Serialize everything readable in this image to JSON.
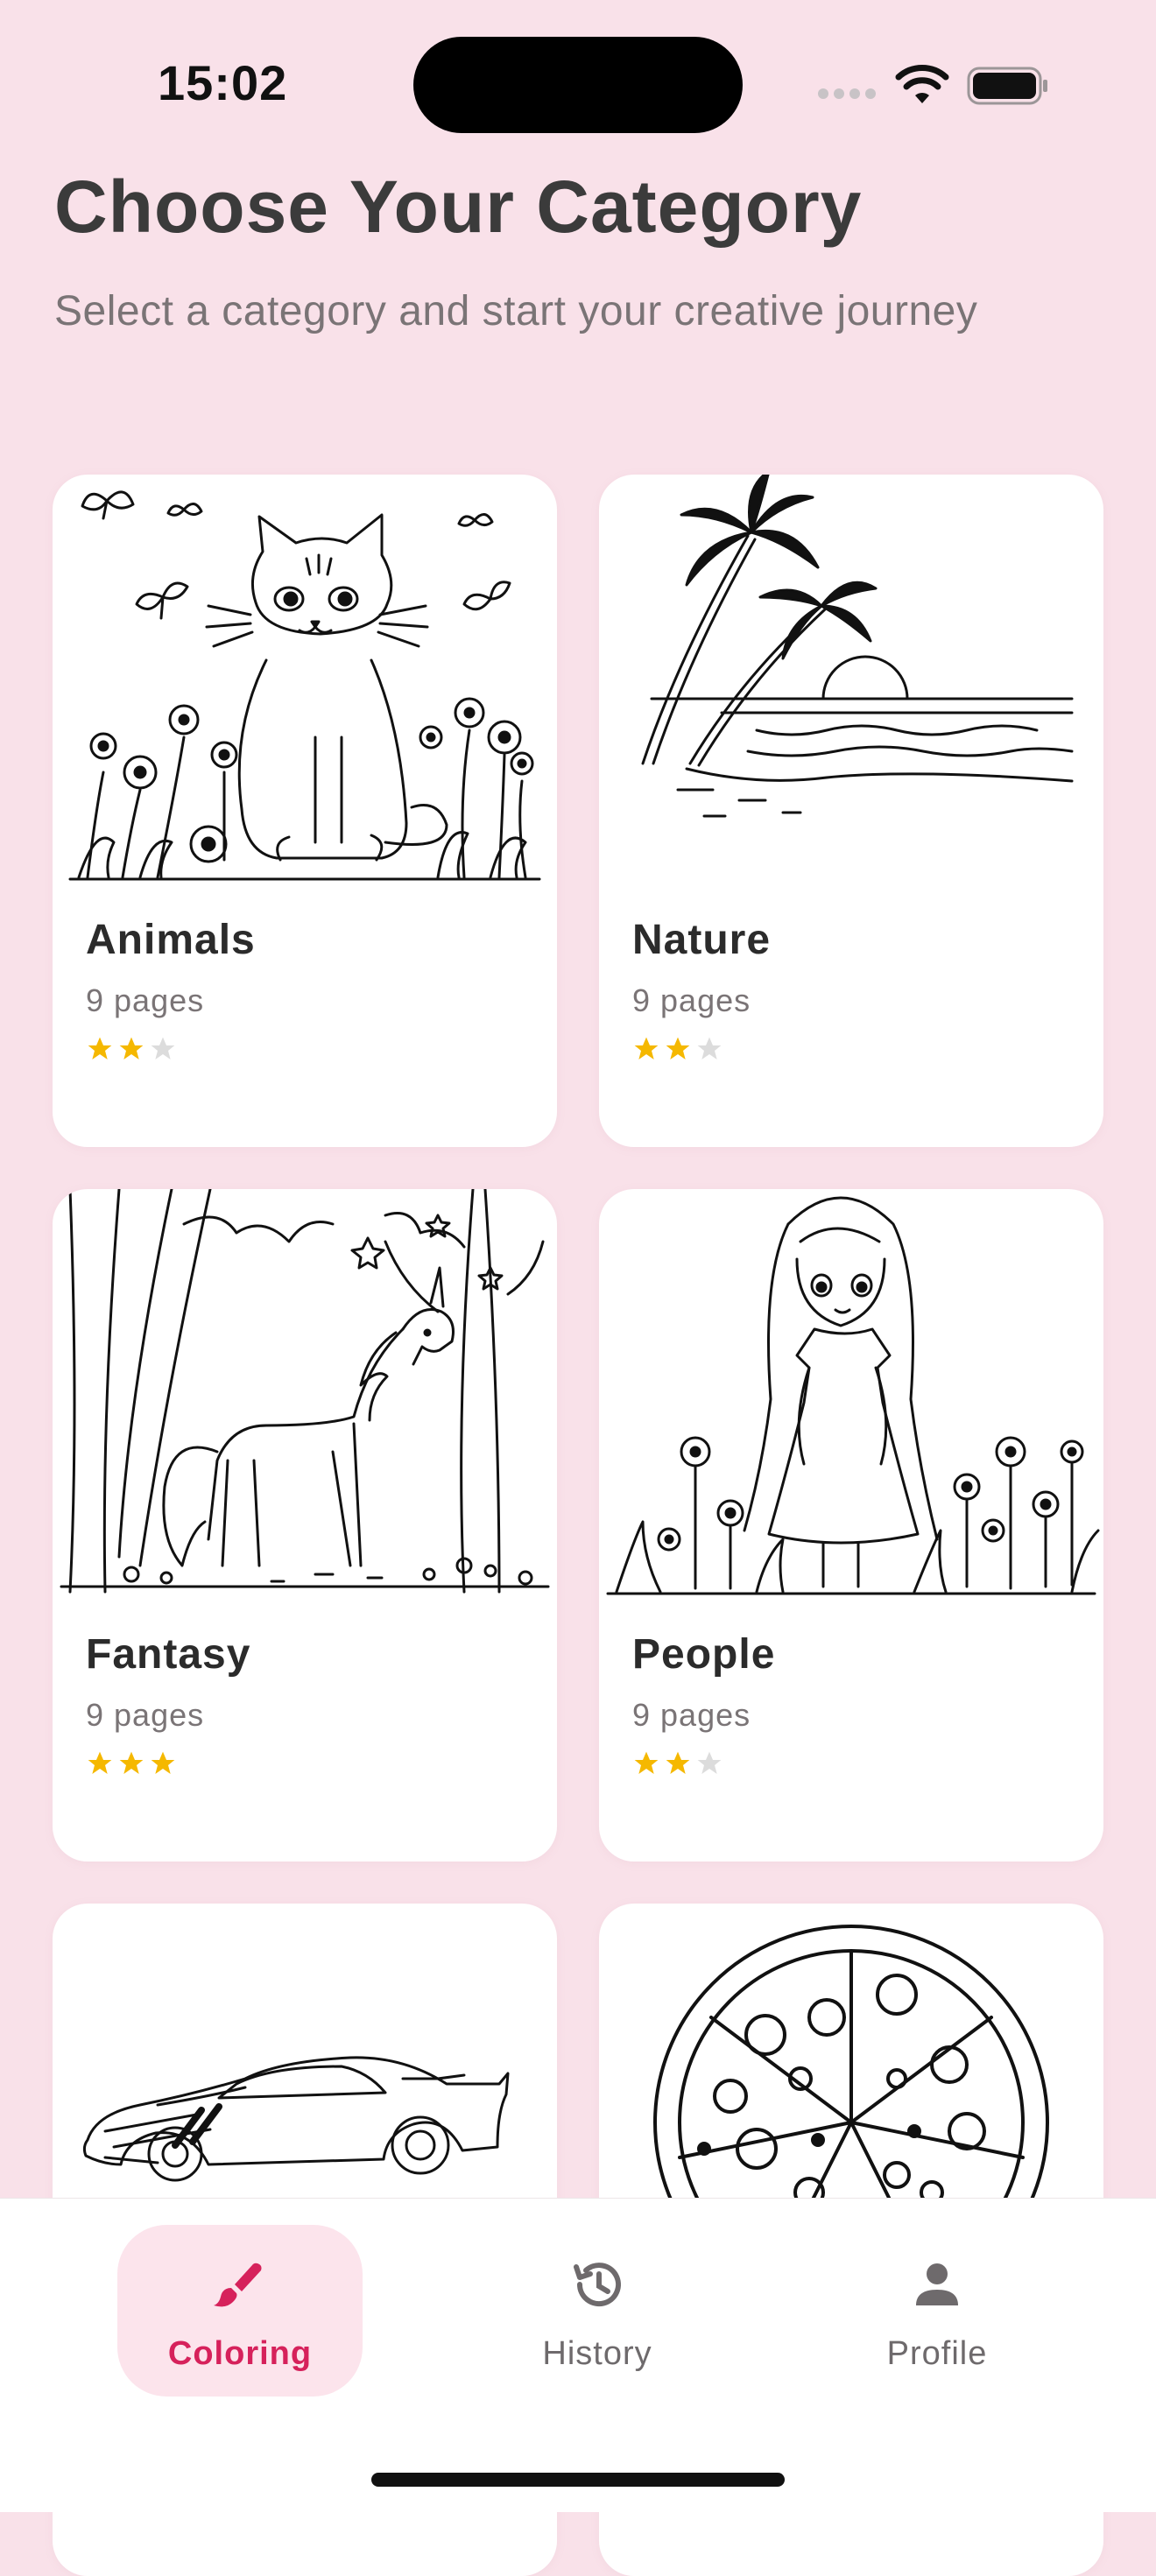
{
  "status_bar": {
    "time": "15:02"
  },
  "header": {
    "title": "Choose Your Category",
    "subtitle": "Select a category and start your creative journey"
  },
  "colors": {
    "background": "#f9e1e9",
    "accent": "#d6215b",
    "star_filled": "#f5b800",
    "star_empty": "#dcdcdc"
  },
  "categories": [
    {
      "title": "Animals",
      "pages": "9 pages",
      "rating": 2,
      "max_rating": 3,
      "art": "cat-with-butterflies-and-flowers"
    },
    {
      "title": "Nature",
      "pages": "9 pages",
      "rating": 2,
      "max_rating": 3,
      "art": "palm-trees-beach-sunset"
    },
    {
      "title": "Fantasy",
      "pages": "9 pages",
      "rating": 3,
      "max_rating": 3,
      "art": "unicorn-in-forest"
    },
    {
      "title": "People",
      "pages": "9 pages",
      "rating": 2,
      "max_rating": 3,
      "art": "girl-in-flower-field"
    },
    {
      "title": "",
      "pages": "",
      "art": "sports-car"
    },
    {
      "title": "",
      "pages": "",
      "art": "pizza"
    }
  ],
  "bottom_nav": {
    "items": [
      {
        "label": "Coloring",
        "icon": "brush-icon",
        "active": true
      },
      {
        "label": "History",
        "icon": "history-icon",
        "active": false
      },
      {
        "label": "Profile",
        "icon": "person-icon",
        "active": false
      }
    ]
  }
}
